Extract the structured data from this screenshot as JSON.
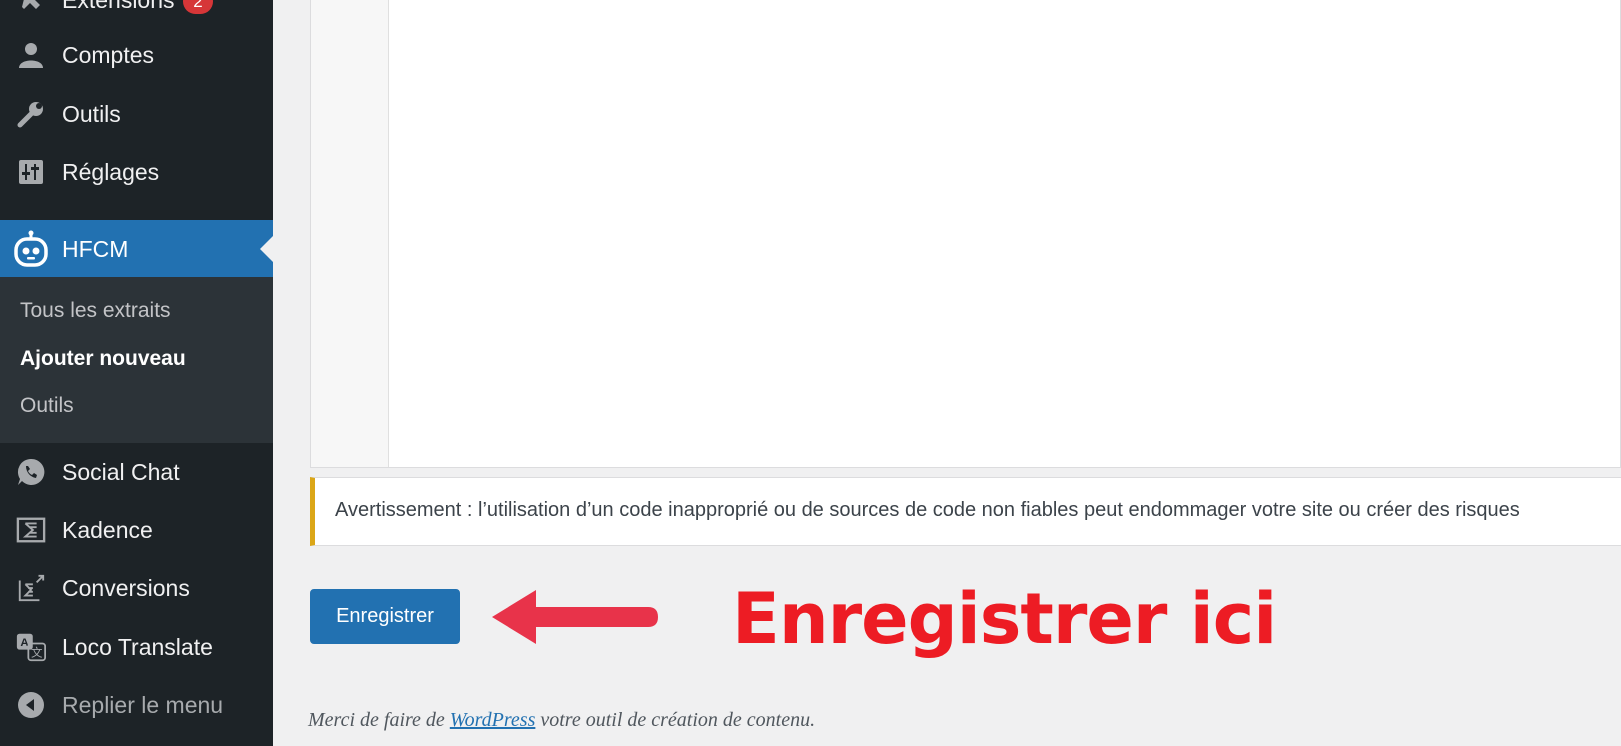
{
  "sidebar": {
    "extensions": {
      "label": "Extensions",
      "badge": "2",
      "icon": "plugin-icon"
    },
    "comptes": {
      "label": "Comptes",
      "icon": "user-icon"
    },
    "outils": {
      "label": "Outils",
      "icon": "wrench-icon"
    },
    "reglages": {
      "label": "Réglages",
      "icon": "sliders-icon"
    },
    "hfcm": {
      "label": "HFCM",
      "icon": "robot-icon"
    },
    "submenu": {
      "all_snippets": "Tous les extraits",
      "add_new": "Ajouter nouveau",
      "tools": "Outils"
    },
    "social_chat": {
      "label": "Social Chat",
      "icon": "whatsapp-icon"
    },
    "kadence": {
      "label": "Kadence",
      "icon": "kadence-icon"
    },
    "conversions": {
      "label": "Conversions",
      "icon": "conversions-icon"
    },
    "loco": {
      "label": "Loco Translate",
      "icon": "translate-icon"
    },
    "collapse": {
      "label": "Replier le menu",
      "icon": "collapse-icon"
    }
  },
  "notice": {
    "text": "Avertissement : l’utilisation d’un code inapproprié ou de sources de code non fiables peut endommager votre site ou créer des risques"
  },
  "actions": {
    "save_label": "Enregistrer"
  },
  "annotation": {
    "text": "Enregistrer ici",
    "color": "#ed1c24"
  },
  "footer": {
    "prefix": "Merci de faire de ",
    "link": "WordPress",
    "suffix": " votre outil de création de contenu."
  },
  "colors": {
    "sidebar_bg": "#1d2327",
    "accent": "#2271b1",
    "warning_border": "#dba617",
    "badge": "#d63638"
  }
}
